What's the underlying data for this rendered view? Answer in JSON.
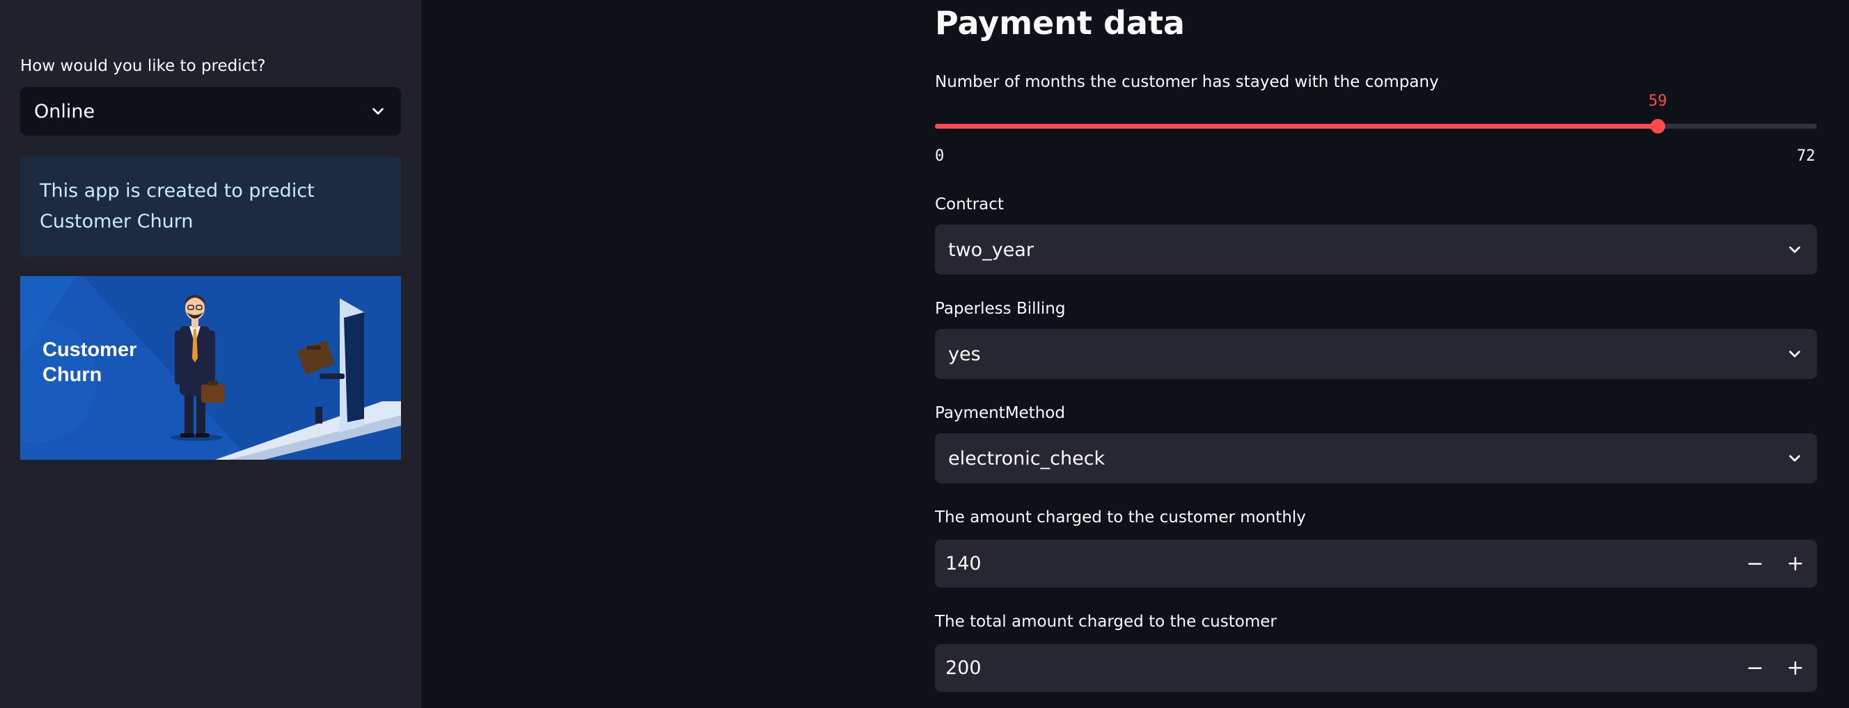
{
  "sidebar": {
    "predict_label": "How would you like to predict?",
    "predict_select": {
      "value": "Online"
    },
    "info_text": "This app is created to predict Customer Churn",
    "banner": {
      "title_line1": "Customer",
      "title_line2": "Churn"
    }
  },
  "main": {
    "title": "Payment data",
    "tenure": {
      "label": "Number of months the customer has stayed with the company",
      "value": 59,
      "value_text": "59",
      "min": 0,
      "min_text": "0",
      "max": 72,
      "max_text": "72"
    },
    "contract": {
      "label": "Contract",
      "value": "two_year"
    },
    "paperless": {
      "label": "Paperless Billing",
      "value": "yes"
    },
    "payment_method": {
      "label": "PaymentMethod",
      "value": "electronic_check"
    },
    "monthly_charges": {
      "label": "The amount charged to the customer monthly",
      "value": "140"
    },
    "total_charges": {
      "label": "The total amount charged to the customer",
      "value": "200"
    },
    "stepper": {
      "minus": "−",
      "plus": "+"
    }
  },
  "colors": {
    "accent": "#ff4b4b",
    "background": "#0e1117",
    "sidebar": "#20212a",
    "widget": "#262730",
    "info_bg": "#1c2b40",
    "info_text": "#c7ebff"
  },
  "icons": {
    "select_chevron": "chevron-down-icon"
  }
}
